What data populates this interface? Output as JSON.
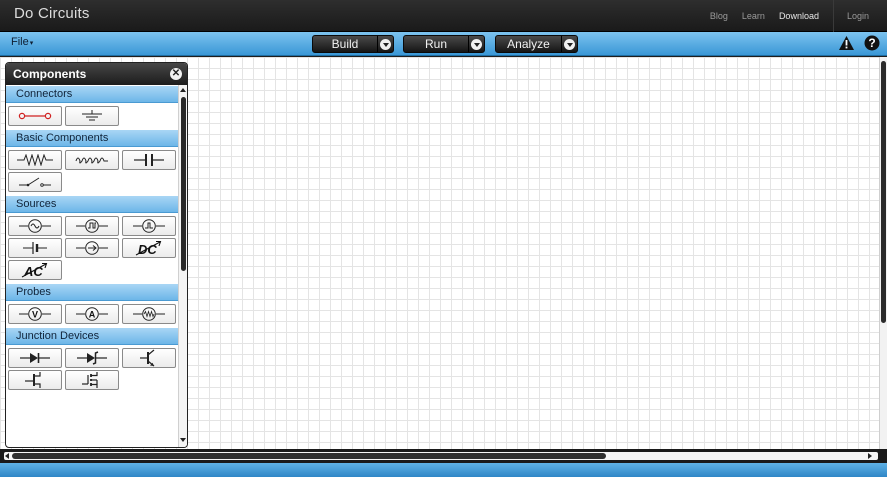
{
  "app": {
    "title": "Do Circuits"
  },
  "topnav": [
    {
      "label": "Blog"
    },
    {
      "label": "Learn"
    },
    {
      "label": "Download"
    },
    {
      "label": "Login"
    }
  ],
  "toolbar": {
    "file_label": "File",
    "file_caret": "▾",
    "buttons": [
      {
        "label": "Build"
      },
      {
        "label": "Run"
      },
      {
        "label": "Analyze"
      }
    ],
    "warning_icon": "warning-icon",
    "help_icon": "help-icon"
  },
  "panel": {
    "title": "Components",
    "close_glyph": "✕",
    "sections": [
      {
        "title": "Connectors",
        "items": [
          "wire",
          "ground"
        ]
      },
      {
        "title": "Basic Components",
        "items": [
          "resistor",
          "inductor",
          "capacitor",
          "switch"
        ]
      },
      {
        "title": "Sources",
        "items": [
          "ac-voltage-source",
          "square-wave-source",
          "pulse-source",
          "dc-voltage-source",
          "current-source",
          "dc-source-variable",
          "ac-source-variable"
        ]
      },
      {
        "title": "Probes",
        "items": [
          "voltmeter",
          "ammeter",
          "ohmmeter"
        ]
      },
      {
        "title": "Junction Devices",
        "items": [
          "diode",
          "zener-diode",
          "bjt-transistor",
          "jfet-transistor",
          "mosfet-transistor"
        ]
      }
    ]
  },
  "colors": {
    "toolbar_blue": "#3a97d6",
    "section_blue": "#6db6e8",
    "wire_red": "#d02020"
  }
}
